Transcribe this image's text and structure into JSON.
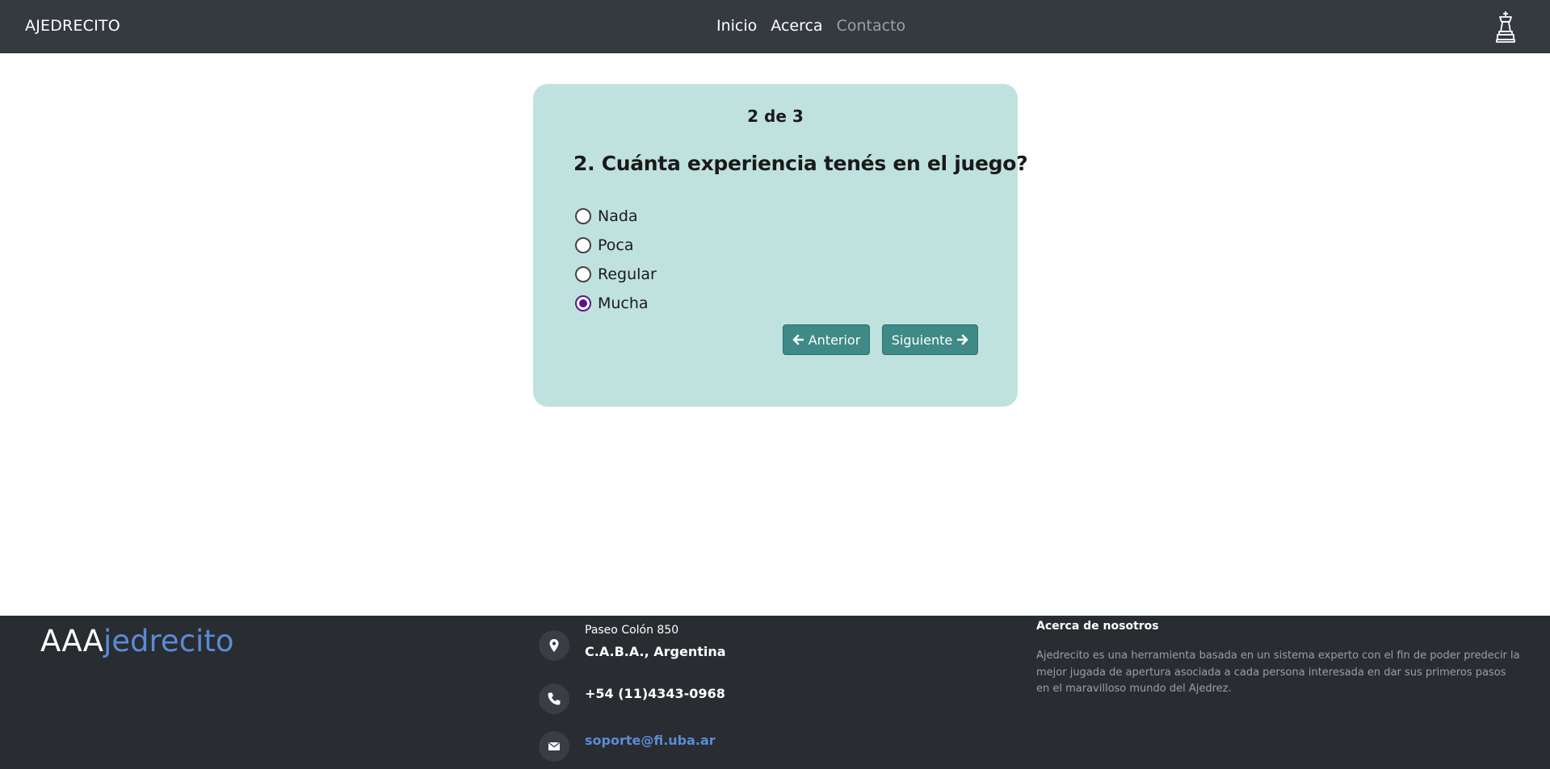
{
  "navbar": {
    "brand": "AJEDRECITO",
    "links": [
      {
        "label": "Inicio"
      },
      {
        "label": "Acerca"
      },
      {
        "label": "Contacto"
      }
    ],
    "icon": "chess-king-icon"
  },
  "quiz": {
    "progress": "2 de 3",
    "question": "2. Cuánta experiencia tenés en el juego?",
    "options": [
      {
        "label": "Nada",
        "selected": false
      },
      {
        "label": "Poca",
        "selected": false
      },
      {
        "label": "Regular",
        "selected": false
      },
      {
        "label": "Mucha",
        "selected": true
      }
    ],
    "prev_label": "Anterior",
    "next_label": "Siguiente",
    "colors": {
      "card": "#c0e2df",
      "button": "#3f8a87",
      "radio_selected": "#5b138f"
    }
  },
  "footer": {
    "logo_part1": "AAA",
    "logo_part2": "jedrecito",
    "address_line1": "Paseo Colón 850",
    "address_line2": "C.A.B.A., Argentina",
    "phone": "+54 (11)4343-0968",
    "email": "soporte@fi.uba.ar",
    "about_title": "Acerca de nosotros",
    "about_text": "Ajedrecito es una herramienta basada en un sistema experto con el fin de poder predecir la mejor jugada de apertura asociada a cada persona interesada en dar sus primeros pasos en el maravilloso mundo del Ajedrez.",
    "icons": [
      "map-pin-icon",
      "phone-icon",
      "envelope-icon"
    ],
    "colors": {
      "background": "#292c31",
      "accent": "#5b8bd6"
    }
  }
}
